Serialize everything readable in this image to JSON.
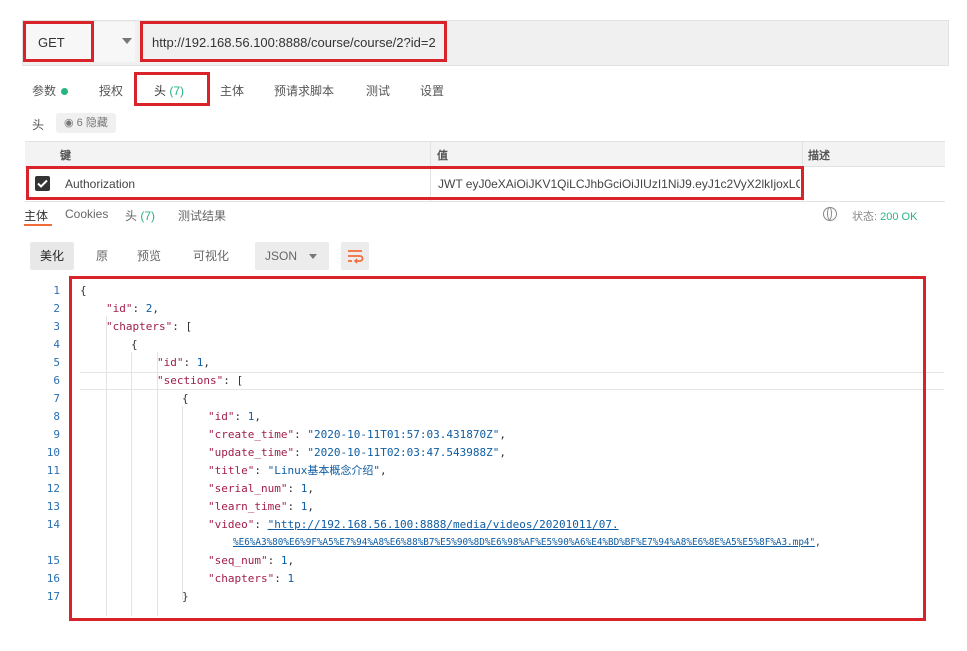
{
  "request": {
    "method": "GET",
    "url": "http://192.168.56.100:8888/course/course/2?id=2"
  },
  "req_tabs": [
    {
      "label": "参数"
    },
    {
      "label": "授权"
    },
    {
      "label": "头",
      "count": "(7)"
    },
    {
      "label": "主体"
    },
    {
      "label": "预请求脚本"
    },
    {
      "label": "测试"
    },
    {
      "label": "设置"
    }
  ],
  "headers": {
    "label": "头",
    "hidden_text": "6 隐藏",
    "columns": {
      "key": "键",
      "value": "值",
      "desc": "描述"
    },
    "row": {
      "checked": true,
      "key": "Authorization",
      "value": "JWT eyJ0eXAiOiJKV1QiLCJhbGciOiJIUzI1NiJ9.eyJ1c2VyX2lkIjoxLC..."
    }
  },
  "resp_tabs": {
    "body": "主体",
    "cookies": "Cookies",
    "headers": "头",
    "headers_count": "(7)",
    "tests": "测试结果"
  },
  "status": {
    "label": "状态:",
    "value": "200 OK"
  },
  "format": {
    "pretty": "美化",
    "raw": "原",
    "preview": "预览",
    "visualize": "可视化",
    "type": "JSON"
  },
  "code": {
    "l1": "{",
    "l2_key": "\"id\"",
    "l2_val": "2",
    "l3_key": "\"chapters\"",
    "l3_tail": ": [",
    "l4": "{",
    "l5_key": "\"id\"",
    "l5_val": "1",
    "l6_key": "\"sections\"",
    "l6_tail": ": [",
    "l7": "{",
    "l8_key": "\"id\"",
    "l8_val": "1",
    "l9_key": "\"create_time\"",
    "l9_val": "\"2020-10-11T01:57:03.431870Z\"",
    "l10_key": "\"update_time\"",
    "l10_val": "\"2020-10-11T02:03:47.543988Z\"",
    "l11_key": "\"title\"",
    "l11_val": "\"Linux基本概念介绍\"",
    "l12_key": "\"serial_num\"",
    "l12_val": "1",
    "l13_key": "\"learn_time\"",
    "l13_val": "1",
    "l14_key": "\"video\"",
    "l14_val1": "\"http://192.168.56.100:8888/media/videos/20201011/07.",
    "l14_val2": "%E6%A3%80%E6%9F%A5%E7%94%A8%E6%88%B7%E5%90%8D%E6%98%AF%E5%90%A6%E4%BD%BF%E7%94%A8%E6%8E%A5%E5%8F%A3.mp4\"",
    "l15_key": "\"seq_num\"",
    "l15_val": "1",
    "l16_key": "\"chapters\"",
    "l16_val": "1",
    "l17": "}"
  },
  "line_numbers": [
    "1",
    "2",
    "3",
    "4",
    "5",
    "6",
    "7",
    "8",
    "9",
    "10",
    "11",
    "12",
    "13",
    "14",
    "15",
    "16",
    "17"
  ]
}
